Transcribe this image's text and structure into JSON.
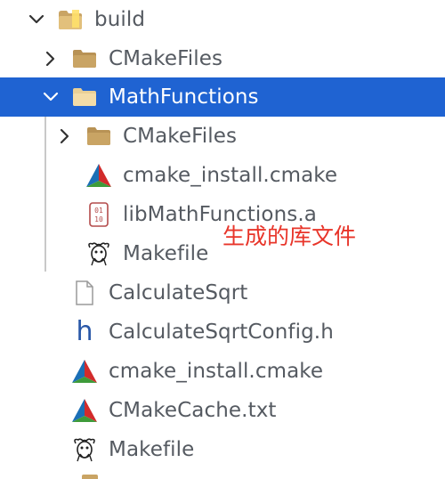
{
  "tree": {
    "items": [
      {
        "label": "build",
        "icon": "home-folder-icon",
        "chevron": "down"
      },
      {
        "label": "CMakeFiles",
        "icon": "folder-icon",
        "chevron": "right"
      },
      {
        "label": "MathFunctions",
        "icon": "folder-icon",
        "chevron": "down",
        "selected": true
      },
      {
        "label": "CMakeFiles",
        "icon": "folder-icon",
        "chevron": "right"
      },
      {
        "label": "cmake_install.cmake",
        "icon": "cmake-icon"
      },
      {
        "label": "libMathFunctions.a",
        "icon": "binary-file-icon"
      },
      {
        "label": "Makefile",
        "icon": "gnu-makefile-icon"
      },
      {
        "label": "CalculateSqrt",
        "icon": "file-icon"
      },
      {
        "label": "CalculateSqrtConfig.h",
        "icon": "header-file-icon"
      },
      {
        "label": "cmake_install.cmake",
        "icon": "cmake-icon"
      },
      {
        "label": "CMakeCache.txt",
        "icon": "cmake-icon"
      },
      {
        "label": "Makefile",
        "icon": "gnu-makefile-icon"
      }
    ]
  },
  "annotation": {
    "text": "生成的库文件",
    "color": "#e8352a"
  },
  "colors": {
    "selection": "#1f63d2",
    "label": "#555a61",
    "folder": "#b89255"
  },
  "icons": {
    "header_glyph": "h"
  }
}
